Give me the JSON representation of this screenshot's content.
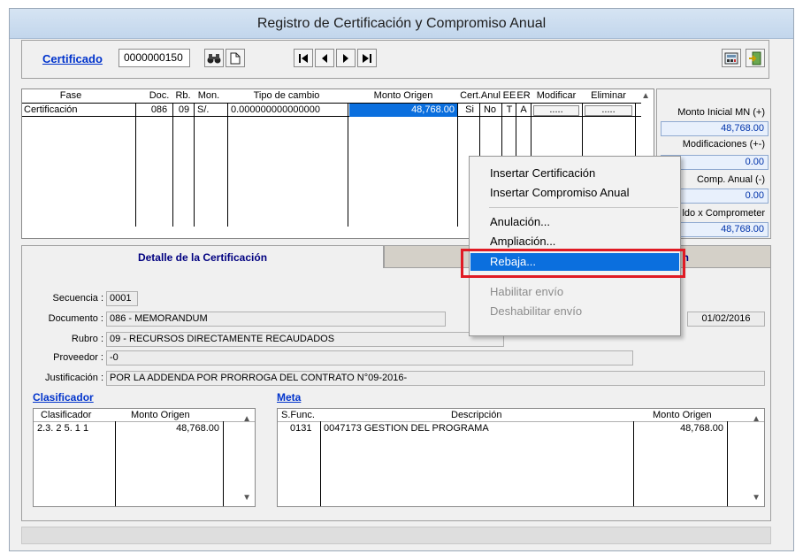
{
  "window": {
    "title": "Registro de Certificación y Compromiso Anual"
  },
  "toolbar": {
    "cert_label": "Certificado",
    "cert_number": "0000000150",
    "search_icon": "binoculars-icon",
    "new_icon": "new-document-icon",
    "nav": [
      "first-record-icon",
      "prev-record-icon",
      "next-record-icon",
      "last-record-icon"
    ],
    "right_icons": [
      "calculator-icon",
      "exit-door-icon"
    ]
  },
  "grid": {
    "headers": [
      "Fase",
      "Doc.",
      "Rb.",
      "Mon.",
      "Tipo de cambio",
      "Monto Origen",
      "Cert.Anul",
      "EE",
      "ER",
      "Modificar",
      "Eliminar"
    ],
    "row": {
      "fase": "Certificación",
      "doc": "086",
      "rb": "09",
      "mon": "S/.",
      "tipo_cambio": "0.000000000000000",
      "monto": "48,768.00",
      "cert": "Si",
      "anul": "No",
      "ee": "T",
      "er": "A",
      "modificar": ".....",
      "eliminar": "....."
    }
  },
  "summary": {
    "monto_inicial_label": "Monto Inicial MN (+)",
    "monto_inicial": "48,768.00",
    "modificaciones_label": "Modificaciones (+-)",
    "modificaciones": "0.00",
    "comp_anual_label": "Comp. Anual (-)",
    "comp_anual": "0.00",
    "saldo_label": "ldo x Comprometer",
    "saldo": "48,768.00"
  },
  "tabs": {
    "detail": "Detalle de la Certificación",
    "other": "n"
  },
  "detail": {
    "secuencia_label": "Secuencia :",
    "secuencia": "0001",
    "documento_label": "Documento :",
    "documento": "086 - MEMORANDUM",
    "fecha": "01/02/2016",
    "rubro_label": "Rubro :",
    "rubro": "09 - RECURSOS DIRECTAMENTE RECAUDADOS",
    "proveedor_label": "Proveedor :",
    "proveedor": "-0",
    "justificacion_label": "Justificación :",
    "justificacion": "POR LA ADDENDA POR PRORROGA DEL CONTRATO N°09-2016-"
  },
  "clasificador": {
    "title": "Clasificador",
    "headers": [
      "Clasificador",
      "Monto Origen"
    ],
    "rows": [
      [
        "2.3. 2 5. 1 1",
        "48,768.00"
      ]
    ]
  },
  "meta": {
    "title": "Meta",
    "headers": [
      "S.Func.",
      "Descripción",
      "Monto Origen"
    ],
    "rows": [
      [
        "0131",
        "0047173  GESTION DEL PROGRAMA",
        "48,768.00"
      ]
    ]
  },
  "context_menu": {
    "items": [
      {
        "label": "Insertar Certificación",
        "enabled": true
      },
      {
        "label": "Insertar Compromiso Anual",
        "enabled": true
      },
      {
        "label": "Anulación...",
        "enabled": true
      },
      {
        "label": "Ampliación...",
        "enabled": true
      },
      {
        "label": "Rebaja...",
        "enabled": true,
        "highlighted": true
      },
      {
        "label": "Habilitar envío",
        "enabled": false
      },
      {
        "label": "Deshabilitar envío",
        "enabled": false
      }
    ],
    "highlight_color": "#0b6fde",
    "focus_outline_color": "#e01b24"
  }
}
